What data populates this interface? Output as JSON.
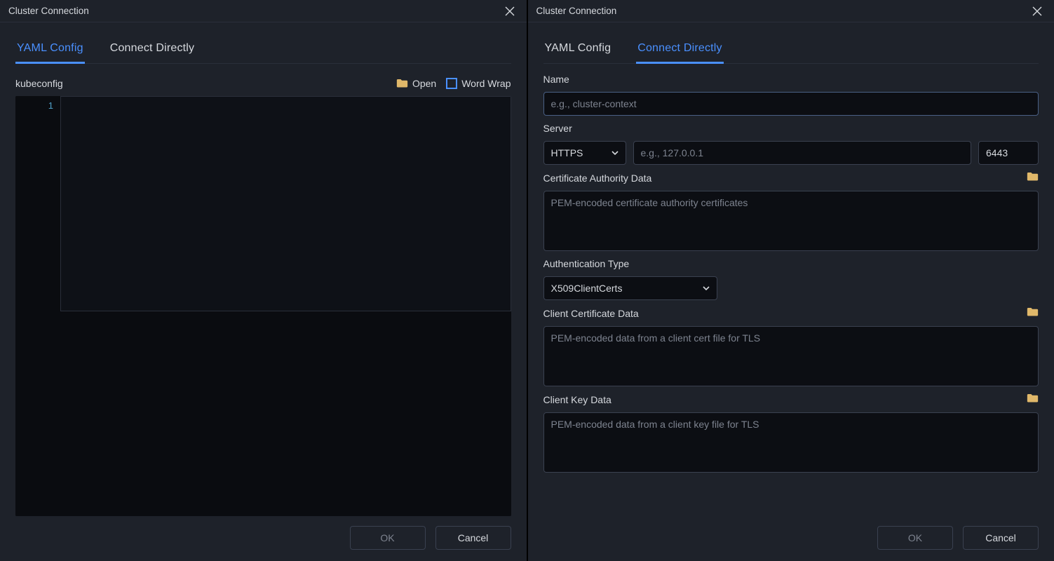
{
  "left": {
    "title": "Cluster Connection",
    "tabs": {
      "yaml": "YAML Config",
      "direct": "Connect  Directly"
    },
    "kubeconfig_label": "kubeconfig",
    "open_label": "Open",
    "wordwrap_label": "Word Wrap",
    "gutter_line1": "1",
    "editor_value": "",
    "buttons": {
      "ok": "OK",
      "cancel": "Cancel"
    }
  },
  "right": {
    "title": "Cluster Connection",
    "tabs": {
      "yaml": "YAML Config",
      "direct": "Connect  Directly"
    },
    "fields": {
      "name": {
        "label": "Name",
        "placeholder": "e.g., cluster-context",
        "value": ""
      },
      "server": {
        "label": "Server",
        "protocol_value": "HTTPS",
        "host_placeholder": "e.g., 127.0.0.1",
        "host_value": "",
        "port_value": "6443"
      },
      "ca": {
        "label": "Certificate Authority Data",
        "placeholder": "PEM-encoded certificate authority certificates",
        "value": ""
      },
      "auth": {
        "label": "Authentication Type",
        "value": "X509ClientCerts"
      },
      "client_cert": {
        "label": "Client Certificate Data",
        "placeholder": "PEM-encoded data from a client cert file for TLS",
        "value": ""
      },
      "client_key": {
        "label": "Client Key Data",
        "placeholder": "PEM-encoded data from a client key file for TLS",
        "value": ""
      }
    },
    "buttons": {
      "ok": "OK",
      "cancel": "Cancel"
    }
  }
}
